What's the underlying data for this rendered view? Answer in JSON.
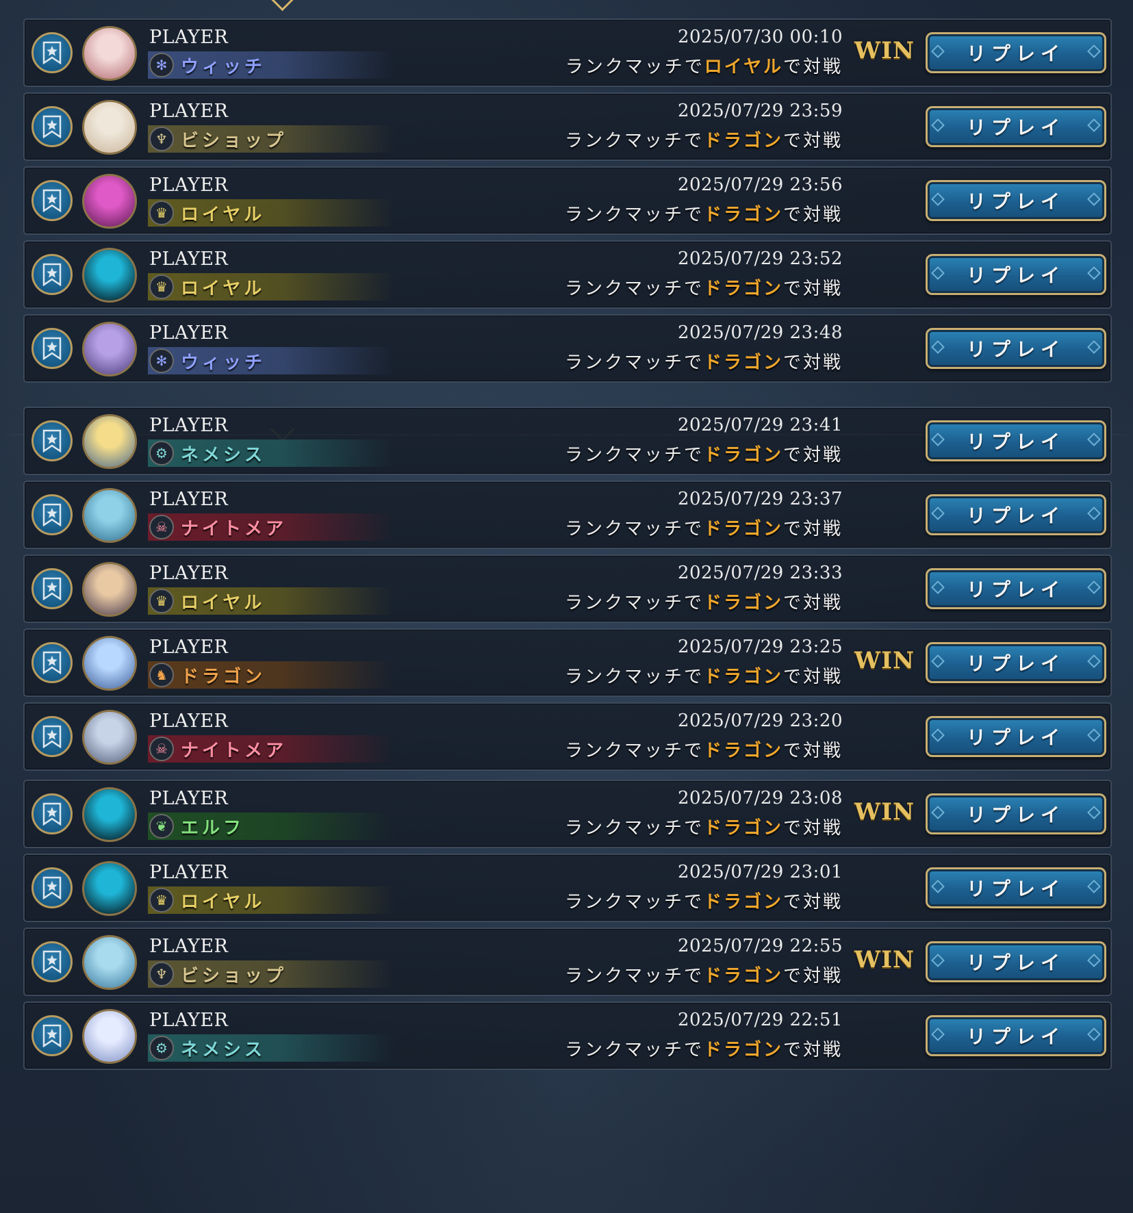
{
  "section_divider_color": "#d6b56a",
  "classes": {
    "witch": {
      "label": "ウィッチ",
      "color": "#8fa0ff",
      "band": "#3a4d7a",
      "icon": "witch-icon",
      "glyph": "✻"
    },
    "bishop": {
      "label": "ビショップ",
      "color": "#d8c690",
      "band": "#5b5632",
      "icon": "bishop-icon",
      "glyph": "♆"
    },
    "royal": {
      "label": "ロイヤル",
      "color": "#e6cf66",
      "band": "#5f5a20",
      "icon": "royal-icon",
      "glyph": "♛"
    },
    "nemesis": {
      "label": "ネメシス",
      "color": "#7fd6d6",
      "band": "#235a5c",
      "icon": "nemesis-icon",
      "glyph": "⚙"
    },
    "nightmare": {
      "label": "ナイトメア",
      "color": "#ff8fa2",
      "band": "#6a1c2a",
      "icon": "nightmare-icon",
      "glyph": "☠"
    },
    "dragon": {
      "label": "ドラゴン",
      "color": "#f0a34b",
      "band": "#5a3a1b",
      "icon": "dragon-icon",
      "glyph": "♞"
    },
    "elf": {
      "label": "エルフ",
      "color": "#84e07e",
      "band": "#1f4d24",
      "icon": "elf-icon",
      "glyph": "❦"
    }
  },
  "rows": [
    {
      "player": "PLAYER",
      "class_key": "witch",
      "datetime": "2025/07/30 00:10",
      "match_prefix": "ランクマッチで",
      "my_class": "ロイヤル",
      "match_suffix": "で対戦",
      "result": "WIN",
      "replay_label": "リプレイ",
      "avatar_colors": [
        "#f3d9d8",
        "#b56e76"
      ]
    },
    {
      "player": "PLAYER",
      "class_key": "bishop",
      "datetime": "2025/07/29 23:59",
      "match_prefix": "ランクマッチで",
      "my_class": "ドラゴン",
      "match_suffix": "で対戦",
      "result": "",
      "replay_label": "リプレイ",
      "avatar_colors": [
        "#efe7da",
        "#c9b59a"
      ]
    },
    {
      "player": "PLAYER",
      "class_key": "royal",
      "datetime": "2025/07/29 23:56",
      "match_prefix": "ランクマッチで",
      "my_class": "ドラゴン",
      "match_suffix": "で対戦",
      "result": "",
      "replay_label": "リプレイ",
      "avatar_colors": [
        "#e05ac7",
        "#5a1a50"
      ]
    },
    {
      "player": "PLAYER",
      "class_key": "royal",
      "datetime": "2025/07/29 23:52",
      "match_prefix": "ランクマッチで",
      "my_class": "ドラゴン",
      "match_suffix": "で対戦",
      "result": "",
      "replay_label": "リプレイ",
      "avatar_colors": [
        "#1fb5d6",
        "#03070c"
      ]
    },
    {
      "player": "PLAYER",
      "class_key": "witch",
      "datetime": "2025/07/29 23:48",
      "match_prefix": "ランクマッチで",
      "my_class": "ドラゴン",
      "match_suffix": "で対戦",
      "result": "",
      "replay_label": "リプレイ",
      "avatar_colors": [
        "#b7a0e6",
        "#4a3c79"
      ]
    },
    {
      "player": "PLAYER",
      "class_key": "nemesis",
      "datetime": "2025/07/29 23:41",
      "match_prefix": "ランクマッチで",
      "my_class": "ドラゴン",
      "match_suffix": "で対戦",
      "result": "",
      "replay_label": "リプレイ",
      "avatar_colors": [
        "#f4dc8a",
        "#4c6b8e"
      ]
    },
    {
      "player": "PLAYER",
      "class_key": "nightmare",
      "datetime": "2025/07/29 23:37",
      "match_prefix": "ランクマッチで",
      "my_class": "ドラゴン",
      "match_suffix": "で対戦",
      "result": "",
      "replay_label": "リプレイ",
      "avatar_colors": [
        "#8fd2e8",
        "#2f6d8e"
      ]
    },
    {
      "player": "PLAYER",
      "class_key": "royal",
      "datetime": "2025/07/29 23:33",
      "match_prefix": "ランクマッチで",
      "my_class": "ドラゴン",
      "match_suffix": "で対戦",
      "result": "",
      "replay_label": "リプレイ",
      "avatar_colors": [
        "#e8c9a4",
        "#4a3b4f"
      ]
    },
    {
      "player": "PLAYER",
      "class_key": "dragon",
      "datetime": "2025/07/29 23:25",
      "match_prefix": "ランクマッチで",
      "my_class": "ドラゴン",
      "match_suffix": "で対戦",
      "result": "WIN",
      "replay_label": "リプレイ",
      "avatar_colors": [
        "#b8d8ff",
        "#3f5f9a"
      ]
    },
    {
      "player": "PLAYER",
      "class_key": "nightmare",
      "datetime": "2025/07/29 23:20",
      "match_prefix": "ランクマッチで",
      "my_class": "ドラゴン",
      "match_suffix": "で対戦",
      "result": "",
      "replay_label": "リプレイ",
      "avatar_colors": [
        "#c7d4e8",
        "#55607a"
      ]
    },
    {
      "player": "PLAYER",
      "class_key": "elf",
      "datetime": "2025/07/29 23:08",
      "match_prefix": "ランクマッチで",
      "my_class": "ドラゴン",
      "match_suffix": "で対戦",
      "result": "WIN",
      "replay_label": "リプレイ",
      "avatar_colors": [
        "#1fb5d6",
        "#03070c"
      ]
    },
    {
      "player": "PLAYER",
      "class_key": "royal",
      "datetime": "2025/07/29 23:01",
      "match_prefix": "ランクマッチで",
      "my_class": "ドラゴン",
      "match_suffix": "で対戦",
      "result": "",
      "replay_label": "リプレイ",
      "avatar_colors": [
        "#1fb5d6",
        "#03070c"
      ]
    },
    {
      "player": "PLAYER",
      "class_key": "bishop",
      "datetime": "2025/07/29 22:55",
      "match_prefix": "ランクマッチで",
      "my_class": "ドラゴン",
      "match_suffix": "で対戦",
      "result": "WIN",
      "replay_label": "リプレイ",
      "avatar_colors": [
        "#a9dbee",
        "#3a7aa0"
      ]
    },
    {
      "player": "PLAYER",
      "class_key": "nemesis",
      "datetime": "2025/07/29 22:51",
      "match_prefix": "ランクマッチで",
      "my_class": "ドラゴン",
      "match_suffix": "で対戦",
      "result": "",
      "replay_label": "リプレイ",
      "avatar_colors": [
        "#e6ecff",
        "#7f8fc4"
      ]
    }
  ]
}
